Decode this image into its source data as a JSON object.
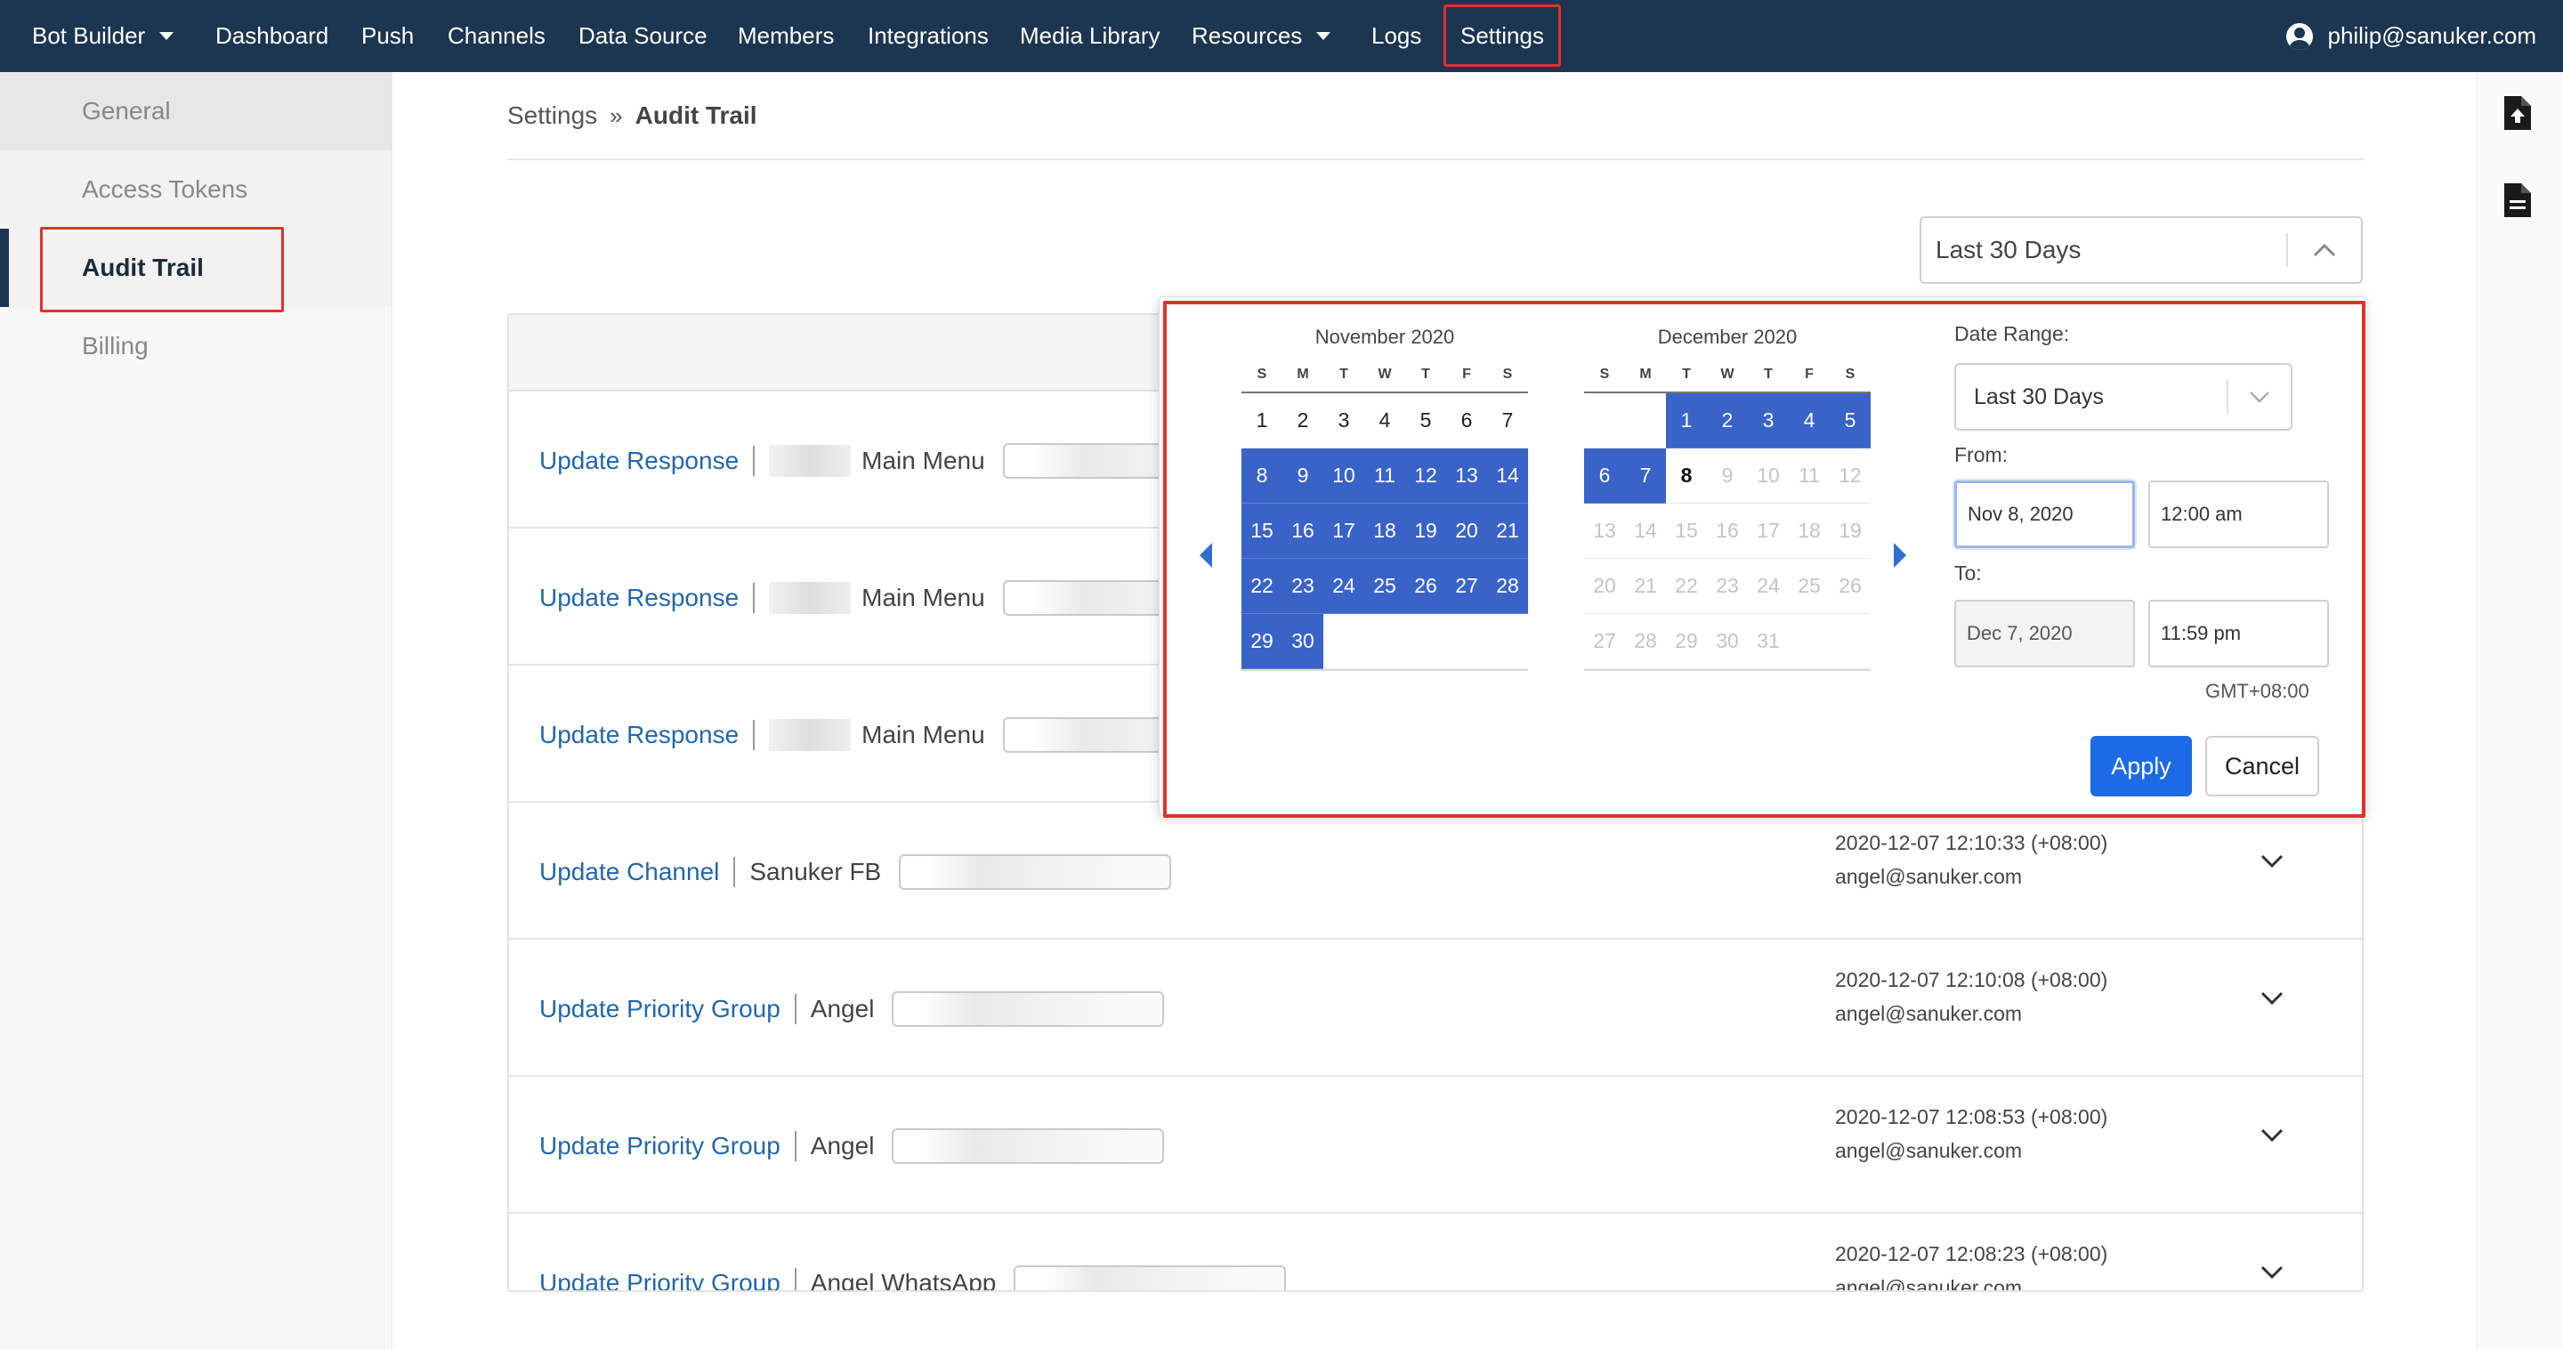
{
  "topnav": {
    "items": [
      {
        "label": "Bot Builder",
        "dropdown": true
      },
      {
        "label": "Dashboard"
      },
      {
        "label": "Push"
      },
      {
        "label": "Channels"
      },
      {
        "label": "Data Source"
      },
      {
        "label": "Members"
      },
      {
        "label": "Integrations"
      },
      {
        "label": "Media Library"
      },
      {
        "label": "Resources",
        "dropdown": true
      },
      {
        "label": "Logs"
      },
      {
        "label": "Settings",
        "active": true
      }
    ],
    "user_email": "philip@sanuker.com"
  },
  "sidebar": {
    "items": [
      {
        "label": "General"
      },
      {
        "label": "Access Tokens"
      },
      {
        "label": "Audit Trail",
        "active": true
      },
      {
        "label": "Billing"
      }
    ]
  },
  "right_rail": {
    "icons": [
      "file-upload-icon",
      "file-icon"
    ]
  },
  "breadcrumb": {
    "parent": "Settings",
    "separator": "»",
    "current": "Audit Trail"
  },
  "date_filter": {
    "value": "Last 30 Days"
  },
  "rows": [
    {
      "action": "Update Response",
      "target": "Main Menu",
      "has_blur_label": true
    },
    {
      "action": "Update Response",
      "target": "Main Menu",
      "has_blur_label": true
    },
    {
      "action": "Update Response",
      "target": "Main Menu",
      "has_blur_label": true
    },
    {
      "action": "Update Channel",
      "target": "Sanuker FB",
      "timestamp": "2020-12-07 12:10:33 (+08:00)",
      "user": "angel@sanuker.com"
    },
    {
      "action": "Update Priority Group",
      "target": "Angel",
      "timestamp": "2020-12-07 12:10:08 (+08:00)",
      "user": "angel@sanuker.com"
    },
    {
      "action": "Update Priority Group",
      "target": "Angel",
      "timestamp": "2020-12-07 12:08:53 (+08:00)",
      "user": "angel@sanuker.com"
    },
    {
      "action": "Update Priority Group",
      "target": "Angel WhatsApp",
      "timestamp": "2020-12-07 12:08:23 (+08:00)",
      "user": "angel@sanuker.com"
    }
  ],
  "datepicker": {
    "weekdays": [
      "S",
      "M",
      "T",
      "W",
      "T",
      "F",
      "S"
    ],
    "months": [
      {
        "title": "November 2020",
        "lead_blanks": 0,
        "days": [
          "1",
          "2",
          "3",
          "4",
          "5",
          "6",
          "7",
          "8",
          "9",
          "10",
          "11",
          "12",
          "13",
          "14",
          "15",
          "16",
          "17",
          "18",
          "19",
          "20",
          "21",
          "22",
          "23",
          "24",
          "25",
          "26",
          "27",
          "28",
          "29",
          "30"
        ],
        "selected": [
          "8",
          "9",
          "10",
          "11",
          "12",
          "13",
          "14",
          "15",
          "16",
          "17",
          "18",
          "19",
          "20",
          "21",
          "22",
          "23",
          "24",
          "25",
          "26",
          "27",
          "28",
          "29",
          "30"
        ],
        "dimmed": [],
        "today": null
      },
      {
        "title": "December 2020",
        "lead_blanks": 2,
        "days": [
          "1",
          "2",
          "3",
          "4",
          "5",
          "6",
          "7",
          "8",
          "9",
          "10",
          "11",
          "12",
          "13",
          "14",
          "15",
          "16",
          "17",
          "18",
          "19",
          "20",
          "21",
          "22",
          "23",
          "24",
          "25",
          "26",
          "27",
          "28",
          "29",
          "30",
          "31"
        ],
        "selected": [
          "1",
          "2",
          "3",
          "4",
          "5",
          "6",
          "7"
        ],
        "dimmed": [
          "9",
          "10",
          "11",
          "12",
          "13",
          "14",
          "15",
          "16",
          "17",
          "18",
          "19",
          "20",
          "21",
          "22",
          "23",
          "24",
          "25",
          "26",
          "27",
          "28",
          "29",
          "30",
          "31"
        ],
        "today": "8"
      }
    ],
    "range_label": "Date Range:",
    "range_value": "Last 30 Days",
    "from_label": "From:",
    "from_date": "Nov 8, 2020",
    "from_time": "12:00 am",
    "to_label": "To:",
    "to_date": "Dec 7, 2020",
    "to_time": "11:59 pm",
    "timezone": "GMT+08:00",
    "apply_label": "Apply",
    "cancel_label": "Cancel"
  },
  "colors": {
    "nav_bg": "#1c3550",
    "selection": "#3a63c8",
    "link": "#2467a8",
    "apply": "#1d6ae5",
    "highlight": "#e0322b"
  }
}
